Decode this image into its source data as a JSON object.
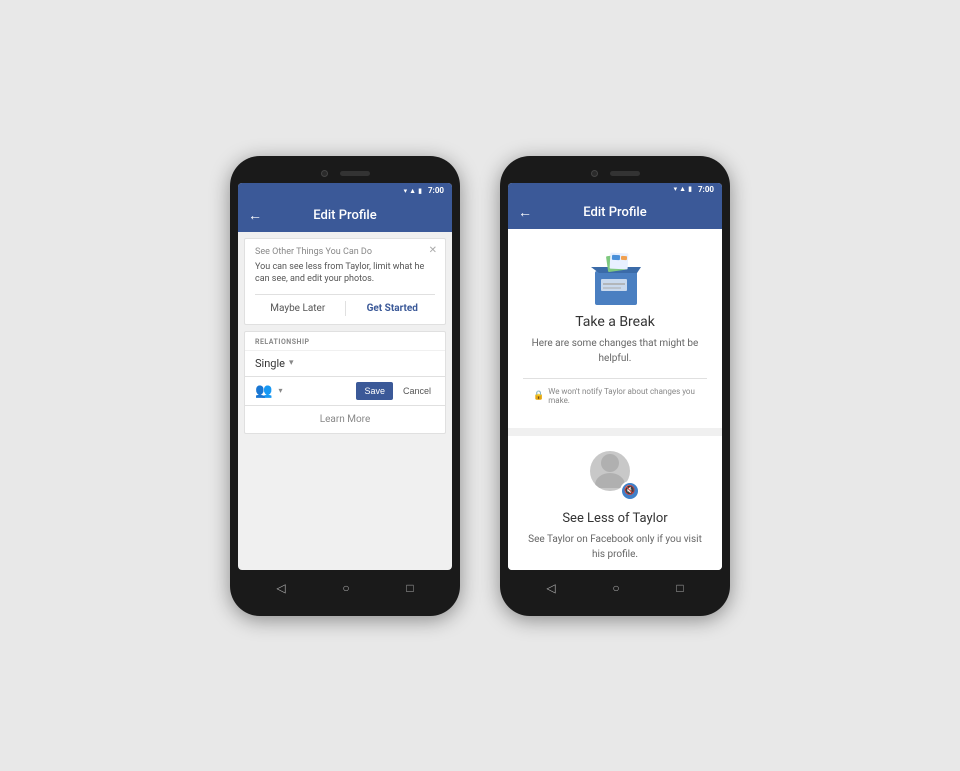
{
  "phones": {
    "left": {
      "status": {
        "time": "7:00"
      },
      "header": {
        "title": "Edit Profile",
        "back_label": "←"
      },
      "notification": {
        "title": "See Other Things You Can Do",
        "body": "You can see less from Taylor, limit what he can see, and edit your photos.",
        "maybe_later": "Maybe Later",
        "get_started": "Get Started"
      },
      "relationship": {
        "label": "RELATIONSHIP",
        "status": "Single",
        "learn_more": "Learn More",
        "save_label": "Save",
        "cancel_label": "Cancel"
      },
      "nav": {
        "back": "◁",
        "home": "○",
        "square": "□"
      }
    },
    "right": {
      "status": {
        "time": "7:00"
      },
      "header": {
        "title": "Edit Profile",
        "back_label": "←"
      },
      "take_break": {
        "title": "Take a Break",
        "description": "Here are some changes that might be helpful.",
        "privacy_note": "We won't notify Taylor about changes you make."
      },
      "see_less": {
        "title": "See Less of Taylor",
        "description": "See Taylor on Facebook only if you visit his profile."
      },
      "nav": {
        "back": "◁",
        "home": "○",
        "square": "□"
      }
    }
  }
}
